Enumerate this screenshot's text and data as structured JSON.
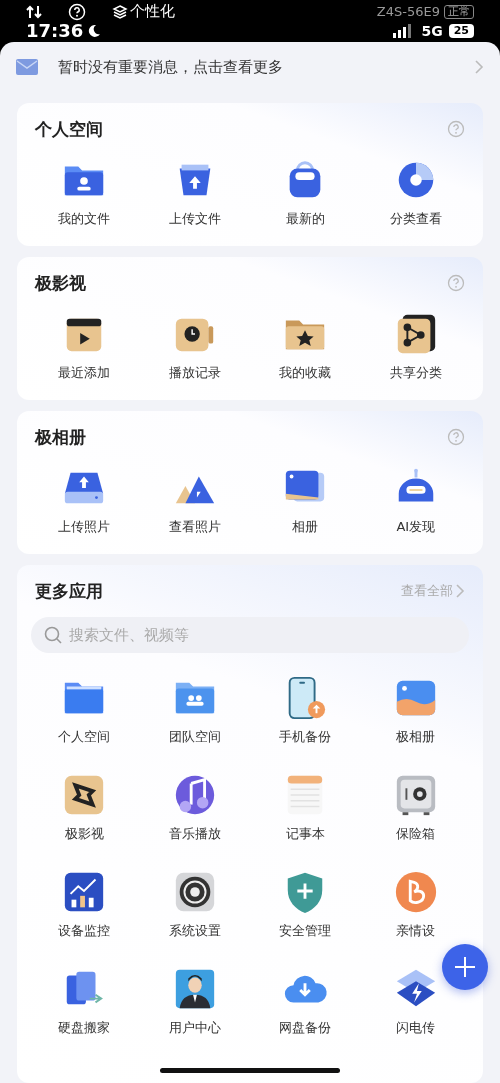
{
  "status_bar": {
    "time": "17:36",
    "personalize": "个性化",
    "device": "Z4S-56E9",
    "device_state": "正常",
    "network": "5G",
    "battery": "25"
  },
  "notice": {
    "text": "暂时没有重要消息，点击查看更多"
  },
  "sections": [
    {
      "title": "个人空间",
      "items": [
        "我的文件",
        "上传文件",
        "最新的",
        "分类查看"
      ]
    },
    {
      "title": "极影视",
      "items": [
        "最近添加",
        "播放记录",
        "我的收藏",
        "共享分类"
      ]
    },
    {
      "title": "极相册",
      "items": [
        "上传照片",
        "查看照片",
        "相册",
        "AI发现"
      ]
    }
  ],
  "more_apps": {
    "title": "更多应用",
    "link": "查看全部",
    "search": {
      "placeholder": "搜索文件、视频等"
    },
    "apps": [
      "个人空间",
      "团队空间",
      "手机备份",
      "极相册",
      "极影视",
      "音乐播放",
      "记事本",
      "保险箱",
      "设备监控",
      "系统设置",
      "安全管理",
      "亲情设",
      "硬盘搬家",
      "用户中心",
      "网盘备份",
      "闪电传"
    ]
  }
}
